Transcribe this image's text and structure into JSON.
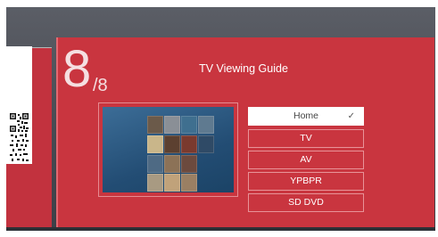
{
  "guide": {
    "page_number": "8",
    "page_total": "/8",
    "title": "TV Viewing Guide"
  },
  "side_card": {
    "caption": "Scan QR code"
  },
  "menu": {
    "items": [
      {
        "label": "Home",
        "selected": true
      },
      {
        "label": "TV",
        "selected": false
      },
      {
        "label": "AV",
        "selected": false
      },
      {
        "label": "YPBPR",
        "selected": false
      },
      {
        "label": "SD DVD",
        "selected": false
      }
    ],
    "check_icon": "check-icon"
  },
  "colors": {
    "panel_red": "#c9353f",
    "screen_bg": "#4b4e56",
    "preview_blue": "#2a5882",
    "selected_bg": "#ffffff"
  }
}
